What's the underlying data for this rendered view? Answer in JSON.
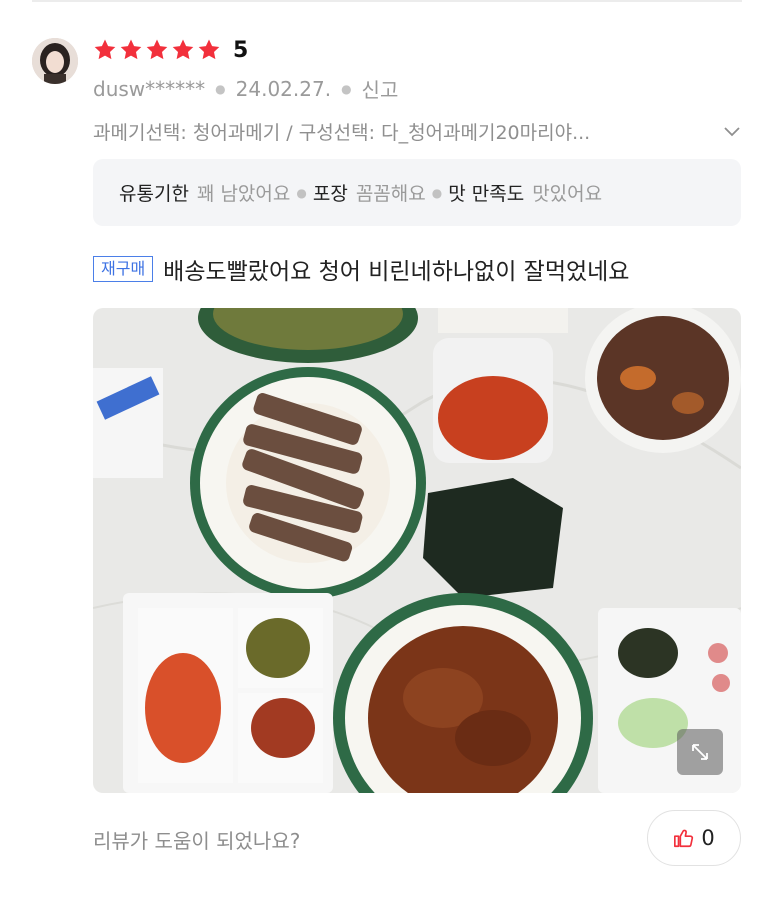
{
  "review": {
    "rating": "5",
    "rating_value": 5,
    "star_color": "#f2303c",
    "user": "dusw******",
    "date": "24.02.27.",
    "report_label": "신고",
    "options_text": "과메기선택: 청어과메기 / 구성선택: 다_청어과메기20마리야...",
    "summary": [
      {
        "key": "유통기한",
        "value": "꽤 남았어요"
      },
      {
        "key": "포장",
        "value": "꼼꼼해요"
      },
      {
        "key": "맛 만족도",
        "value": "맛있어요"
      }
    ],
    "badge": "재구매",
    "text": "배송도빨랐어요 청어 비린네하나없이 잘먹었네요",
    "photo_icon": "expand-icon"
  },
  "footer": {
    "helpful_question": "리뷰가 도움이 되었나요?",
    "like_count": "0",
    "like_color": "#f2303c"
  }
}
